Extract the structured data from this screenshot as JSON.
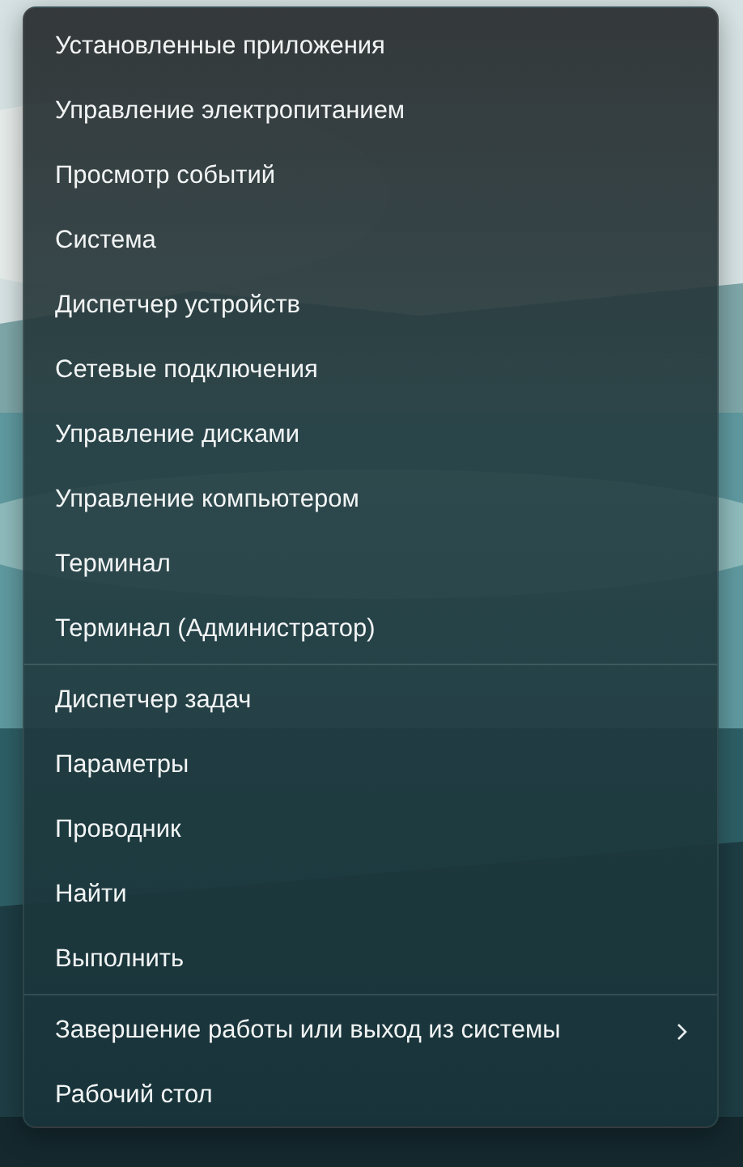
{
  "menu": {
    "groups": [
      {
        "items": [
          {
            "label": "Установленные приложения",
            "submenu": false
          },
          {
            "label": "Управление электропитанием",
            "submenu": false
          },
          {
            "label": "Просмотр событий",
            "submenu": false
          },
          {
            "label": "Система",
            "submenu": false
          },
          {
            "label": "Диспетчер устройств",
            "submenu": false
          },
          {
            "label": "Сетевые подключения",
            "submenu": false
          },
          {
            "label": "Управление дисками",
            "submenu": false
          },
          {
            "label": "Управление компьютером",
            "submenu": false
          },
          {
            "label": "Терминал",
            "submenu": false
          },
          {
            "label": "Терминал (Администратор)",
            "submenu": false
          }
        ]
      },
      {
        "items": [
          {
            "label": "Диспетчер задач",
            "submenu": false
          },
          {
            "label": "Параметры",
            "submenu": false
          },
          {
            "label": "Проводник",
            "submenu": false
          },
          {
            "label": "Найти",
            "submenu": false
          },
          {
            "label": "Выполнить",
            "submenu": false
          }
        ]
      },
      {
        "items": [
          {
            "label": "Завершение работы или выход из системы",
            "submenu": true
          },
          {
            "label": "Рабочий стол",
            "submenu": false
          }
        ]
      }
    ]
  }
}
